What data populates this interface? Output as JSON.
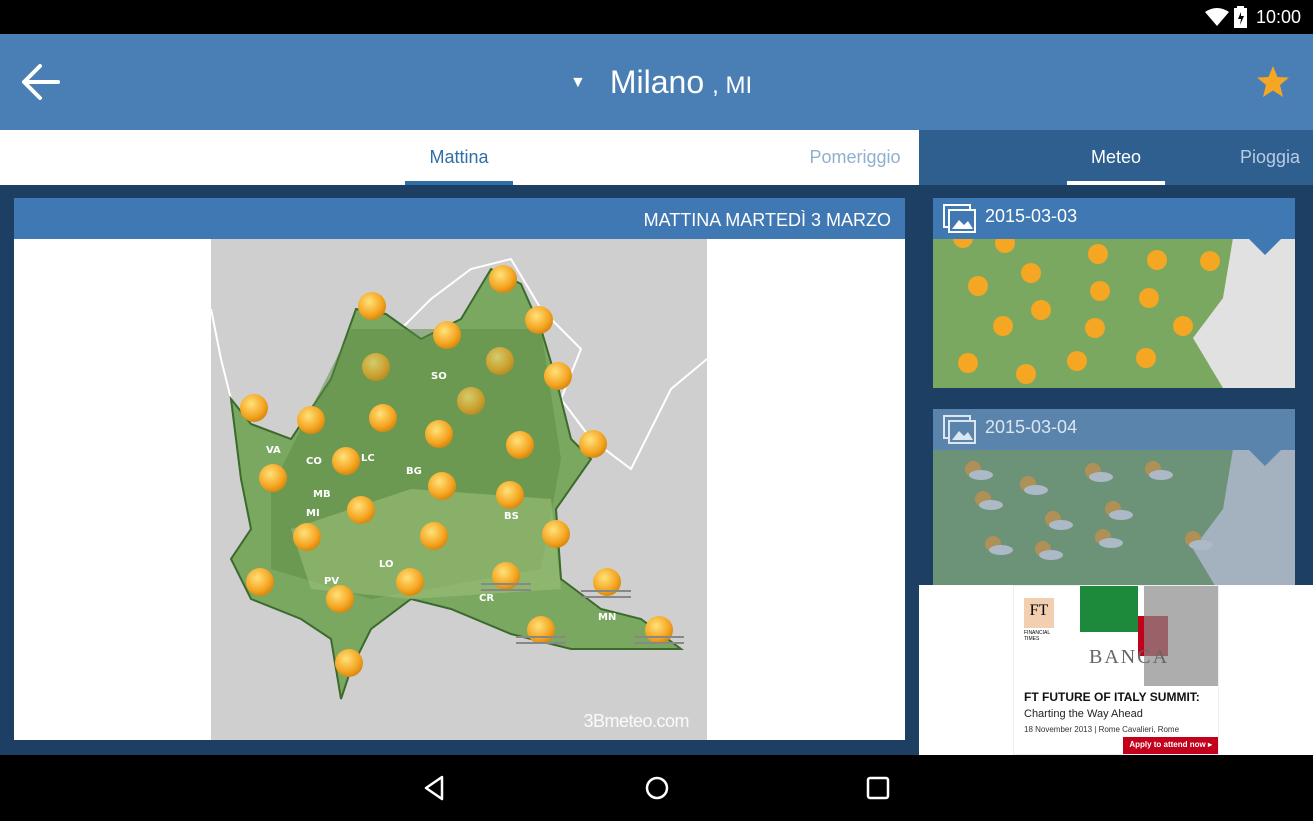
{
  "status_bar": {
    "time": "10:00"
  },
  "app_bar": {
    "caret": "▼",
    "city": "Milano",
    "province": ", MI"
  },
  "left_tabs": [
    {
      "label": "Mattina"
    },
    {
      "label": "Pomeriggio"
    }
  ],
  "right_tabs": [
    {
      "label": "Meteo"
    },
    {
      "label": "Pioggia"
    }
  ],
  "forecast_card": {
    "header": "MATTINA MARTEDÌ 3 MARZO",
    "watermark": "3Bmeteo.com"
  },
  "map_labels": [
    "SO",
    "VA",
    "CO",
    "LC",
    "BG",
    "MB",
    "MI",
    "BS",
    "LO",
    "PV",
    "CR",
    "MN"
  ],
  "thumbnails": [
    {
      "date": "2015-03-03"
    },
    {
      "date": "2015-03-04"
    }
  ],
  "ad": {
    "logo": "FT",
    "logo_sub": "FINANCIAL TIMES",
    "banner_text": "BANCA",
    "title": "FT FUTURE OF ITALY SUMMIT:",
    "subtitle": "Charting the Way Ahead",
    "details": "18 November 2013 | Rome Cavalieri, Rome",
    "cta": "Apply to attend now ▸"
  },
  "colors": {
    "primary": "#4a7fb5",
    "accent": "#f5a623",
    "dark": "#1c3f63"
  }
}
